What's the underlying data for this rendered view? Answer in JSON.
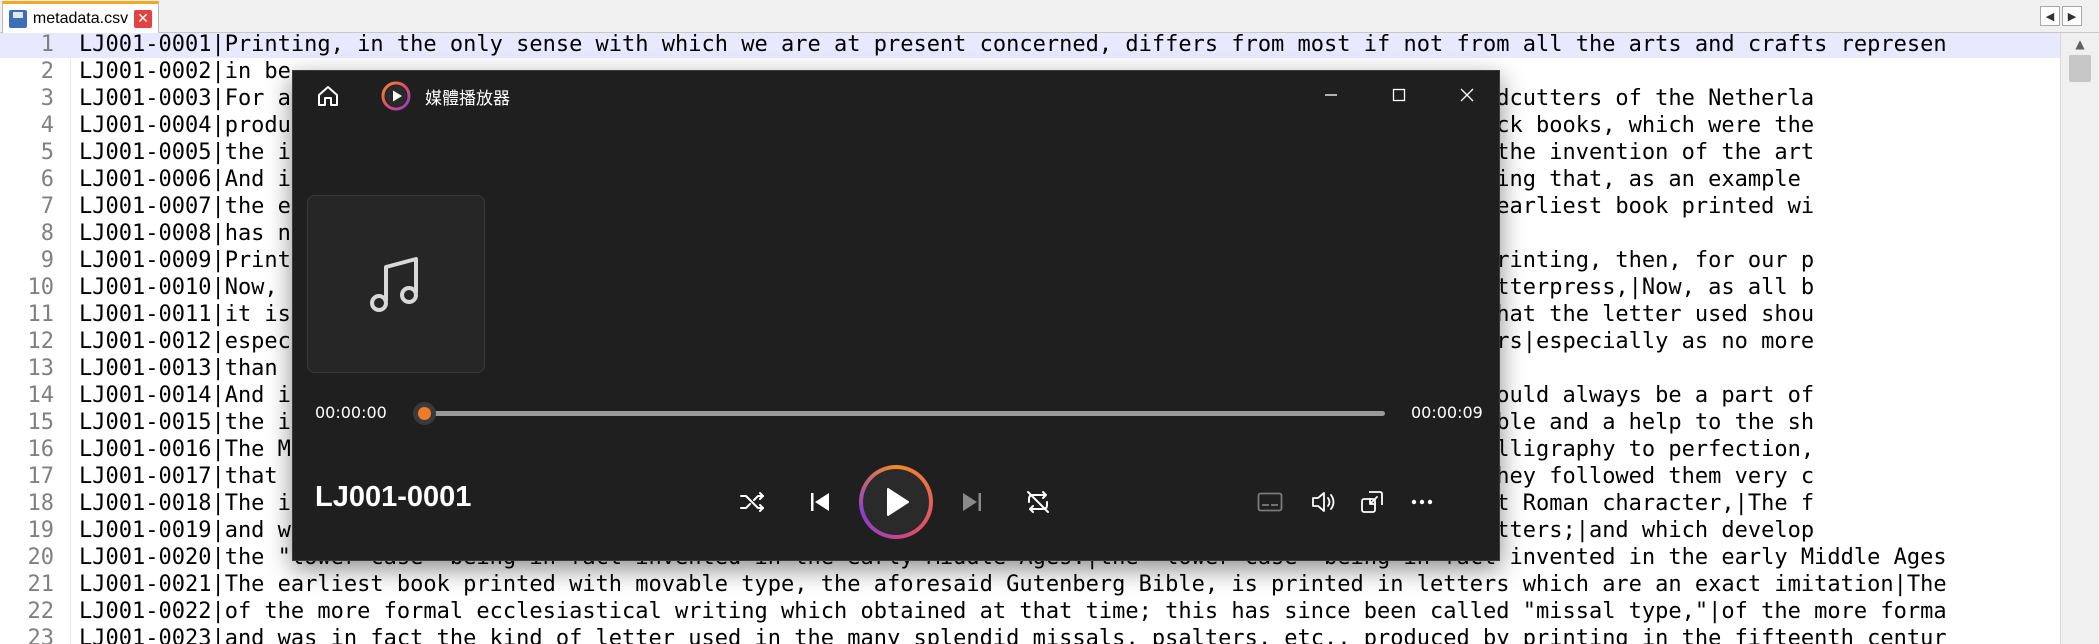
{
  "tab": {
    "filename": "metadata.csv",
    "close_glyph": "✕"
  },
  "tab_nav": {
    "left": "◀",
    "right": "▶"
  },
  "scroll": {
    "up": "▲",
    "edge_dots": "⋮"
  },
  "editor": {
    "lines": [
      {
        "num": "1",
        "text": "LJ001-0001|Printing, in the only sense with which we are at present concerned, differs from most if not from all the arts and crafts represen"
      },
      {
        "num": "2",
        "text": "LJ001-0002|in be"
      },
      {
        "num": "3",
        "text": "LJ001-0003|For a                                                                           s before the woodcutters of the Netherla"
      },
      {
        "num": "4",
        "text": "LJ001-0004|produ                                                                           produced the block books, which were the"
      },
      {
        "num": "5",
        "text": "LJ001-0005|the i                                                                           e considered as the invention of the art"
      },
      {
        "num": "6",
        "text": "LJ001-0006|And i                                                                            mention in passing that, as an example"
      },
      {
        "num": "7",
        "text": "LJ001-0007|the e                                                                           about 1455,|the earliest book printed wi"
      },
      {
        "num": "8",
        "text": "LJ001-0008|has n"
      },
      {
        "num": "9",
        "text": "LJ001-0009|Print                                                                           movable types.|Printing, then, for our p"
      },
      {
        "num": "10",
        "text": "LJ001-0010|Now,                                                                            posed to form letterpress,|Now, as all b"
      },
      {
        "num": "11",
        "text": "LJ001-0011|it is                                                                           rst importance that the letter used shou"
      },
      {
        "num": "12",
        "text": "LJ001-0012|espec                                                                            beautiful letters|especially as no more"
      },
      {
        "num": "13",
        "text": "LJ001-0013|than"
      },
      {
        "num": "14",
        "text": "LJ001-0014|And i                                                                           eautiful form should always be a part of"
      },
      {
        "num": "15",
        "text": "LJ001-0015|the i                                                                           hould be reasonable and a help to the sh"
      },
      {
        "num": "16",
        "text": "LJ001-0016|The M                                                                            Ages brought calligraphy to perfection,"
      },
      {
        "num": "17",
        "text": "LJ001-0017|that                                                                            character, and they followed them very c"
      },
      {
        "num": "18",
        "text": "LJ001-0018|The i                                                                           nt of the ancient Roman character,|The f"
      },
      {
        "num": "19",
        "text": "LJ001-0019|and w                                                                           n the capital letters;|and which develop"
      },
      {
        "num": "20",
        "text": "LJ001-0020|the \"lower case\" being in fact invented in the early Middle Ages.|the \"lower case\" being in fact invented in the early Middle Ages"
      },
      {
        "num": "21",
        "text": "LJ001-0021|The earliest book printed with movable type, the aforesaid Gutenberg Bible, is printed in letters which are an exact imitation|The"
      },
      {
        "num": "22",
        "text": "LJ001-0022|of the more formal ecclesiastical writing which obtained at that time; this has since been called \"missal type,\"|of the more forma"
      },
      {
        "num": "23",
        "text": "LJ001-0023|and was in fact the kind of letter used in the many splendid missals, psalters, etc., produced by printing in the fifteenth centur"
      }
    ]
  },
  "player": {
    "app_title": "媒體播放器",
    "track_title": "LJ001-0001",
    "time_elapsed": "00:00:00",
    "time_total": "00:00:09",
    "progress": 0.0,
    "accent_colors": [
      "#f08a28",
      "#e24b6e",
      "#8a3fd0"
    ],
    "icons": {
      "home": "home-icon",
      "album": "music-note-icon",
      "shuffle": "shuffle-icon",
      "previous": "skip-previous-icon",
      "play": "play-icon",
      "next": "skip-next-icon",
      "repeat": "repeat-icon",
      "captions": "captions-icon",
      "volume": "volume-icon",
      "miniplayer": "mini-player-icon",
      "more": "more-options-icon"
    }
  }
}
